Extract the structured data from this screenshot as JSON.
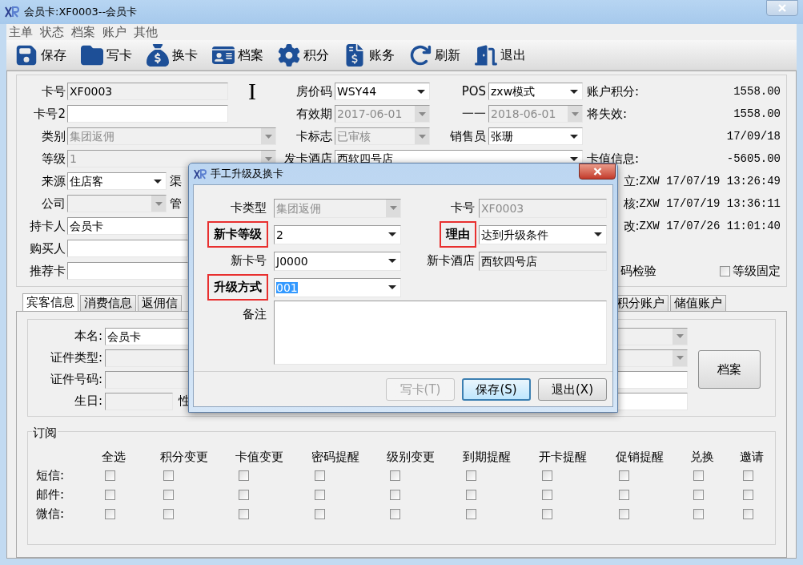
{
  "window": {
    "title": "会员卡:XF0003--会员卡"
  },
  "menu": [
    "主单",
    "状态",
    "档案",
    "账户",
    "其他"
  ],
  "toolbar": [
    "保存",
    "写卡",
    "换卡",
    "档案",
    "积分",
    "账务",
    "刷新",
    "退出"
  ],
  "form": {
    "card_no": {
      "label": "卡号",
      "value": "XF0003",
      "kind": "readonly",
      "disabled": false
    },
    "marker": "I",
    "card_no2": {
      "label": "卡号2",
      "kind": "text",
      "disabled": false
    },
    "category": {
      "label": "类别",
      "value": "集团返佣",
      "kind": "combo",
      "disabled": true
    },
    "level": {
      "label": "等级",
      "value": "1",
      "kind": "combo",
      "disabled": true
    },
    "source": {
      "label": "来源",
      "value": "住店客",
      "kind": "combo",
      "disabled": false
    },
    "channel_label": "渠",
    "company": {
      "label": "公司",
      "kind": "combo",
      "disabled": true
    },
    "manager_label": "管",
    "holder": {
      "label": "持卡人",
      "value": "会员卡",
      "kind": "text",
      "disabled": false
    },
    "buyer": {
      "label": "购买人",
      "kind": "text",
      "disabled": false
    },
    "referrer": {
      "label": "推荐卡",
      "kind": "text",
      "disabled": false
    },
    "rate_code": {
      "label": "房价码",
      "value": "WSY44",
      "kind": "combo",
      "disabled": false
    },
    "valid_from": {
      "label": "有效期",
      "value": "2017-06-01",
      "kind": "combo",
      "disabled": true
    },
    "card_flag": {
      "label": "卡标志",
      "value": "已审核",
      "kind": "combo",
      "disabled": true
    },
    "issue_hotel": {
      "label": "发卡酒店",
      "value": "西软四号店",
      "kind": "combo",
      "disabled": false
    },
    "pos": {
      "label": "POS",
      "value": "zxw模式",
      "kind": "combo",
      "disabled": false
    },
    "valid_to": {
      "label": "一一",
      "value": "2018-06-01",
      "kind": "combo",
      "disabled": true
    },
    "salesperson": {
      "label": "销售员",
      "value": "张珊",
      "kind": "combo",
      "disabled": false
    }
  },
  "info": [
    {
      "kind": "amount",
      "label": "账户积分:",
      "value": "1558.00"
    },
    {
      "kind": "amount",
      "label": "将失效:",
      "value": "1558.00"
    },
    {
      "kind": "amount",
      "value": "17/09/18"
    },
    {
      "kind": "amount",
      "label": "卡值信息:",
      "value": "-5605.00"
    },
    {
      "kind": "log",
      "label": "立:",
      "value": "ZXW 17/07/19 13:26:49"
    },
    {
      "kind": "log",
      "label": "核:",
      "value": "ZXW 17/07/19 13:36:11"
    },
    {
      "kind": "log",
      "label": "改:",
      "value": "ZXW 17/07/26 11:01:40"
    }
  ],
  "password_check": "码检验",
  "level_fixed": {
    "label": "等级固定",
    "checked": false
  },
  "tabs": [
    {
      "label": "宾客信息",
      "selected": true
    },
    {
      "label": "消费信息",
      "selected": false
    },
    {
      "label": "返佣信",
      "selected": false
    },
    {
      "label": "积分账户",
      "selected": false
    },
    {
      "label": "储值账户",
      "selected": false
    }
  ],
  "guest": {
    "name": {
      "label": "本名:",
      "value": "会员卡",
      "kind": "text",
      "disabled": false
    },
    "id_type": {
      "label": "证件类型:",
      "kind": "text",
      "disabled": true
    },
    "id_no": {
      "label": "证件号码:",
      "kind": "text",
      "disabled": true
    },
    "birthday": {
      "label": "生日:",
      "kind": "text",
      "disabled": true
    },
    "gender_label": "性",
    "right_fields": [
      {
        "kind": "combo",
        "disabled": true
      },
      {
        "kind": "combo",
        "disabled": true
      },
      {
        "kind": "text",
        "disabled": false
      },
      {
        "kind": "text",
        "disabled": false
      }
    ],
    "archive_button": "档案"
  },
  "subscription": {
    "title": "订阅",
    "columns": [
      "全选",
      "积分变更",
      "卡值变更",
      "密码提醒",
      "级别变更",
      "到期提醒",
      "开卡提醒",
      "促销提醒",
      "兑换",
      "邀请"
    ],
    "rows": [
      {
        "label": "短信:",
        "checks": [
          false,
          false,
          false,
          false,
          false,
          false,
          false,
          false,
          false,
          false
        ]
      },
      {
        "label": "邮件:",
        "checks": [
          false,
          false,
          false,
          false,
          false,
          false,
          false,
          false,
          false,
          false
        ]
      },
      {
        "label": "微信:",
        "checks": [
          false,
          false,
          false,
          false,
          false,
          false,
          false,
          false,
          false,
          false
        ]
      }
    ]
  },
  "dialog": {
    "title": "手工升级及换卡",
    "left": [
      {
        "label": "卡类型",
        "value": "集团返佣",
        "kind": "combo",
        "disabled": true,
        "highlighted": false
      },
      {
        "label": "新卡等级",
        "value": "2",
        "kind": "combo",
        "disabled": false,
        "highlighted": true
      },
      {
        "label": "新卡号",
        "value": "J0000",
        "kind": "combo",
        "disabled": false,
        "highlighted": false
      },
      {
        "label": "升级方式",
        "value": "001",
        "kind": "combo",
        "disabled": false,
        "highlighted": true,
        "selected_text": true
      }
    ],
    "right": [
      {
        "label": "卡号",
        "value": "XF0003",
        "kind": "text",
        "disabled": true,
        "highlighted": false
      },
      {
        "label": "理由",
        "value": "达到升级条件",
        "kind": "combo",
        "disabled": false,
        "highlighted": true
      },
      {
        "label": "新卡酒店",
        "value": "西软四号店",
        "kind": "readonly",
        "disabled": false,
        "highlighted": false
      }
    ],
    "remark": {
      "label": "备注"
    },
    "buttons": [
      {
        "label": "写卡(T)",
        "disabled": true,
        "focused": false
      },
      {
        "label": "保存(S)",
        "disabled": false,
        "focused": true
      },
      {
        "label": "退出(X)",
        "disabled": false,
        "focused": false
      }
    ]
  }
}
